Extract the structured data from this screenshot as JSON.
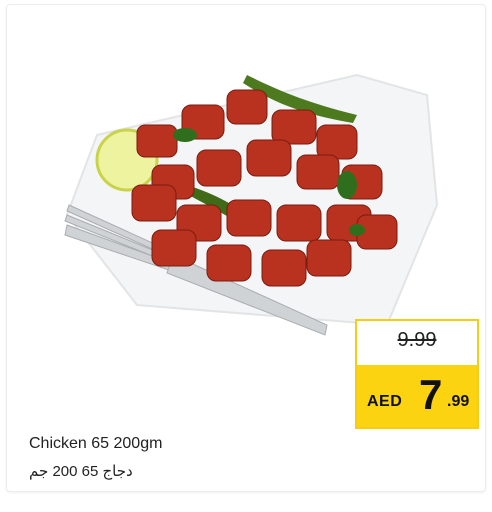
{
  "product": {
    "name_en": "Chicken 65 200gm",
    "name_ar": "دجاج 65  200 جم",
    "image": "chicken-65-plate-image"
  },
  "pricing": {
    "old_price": "9.99",
    "currency": "AED",
    "price_integer": "7",
    "price_decimal": ".99"
  },
  "colors": {
    "price_band": "#fbd311",
    "price_border": "#f7cd12",
    "text": "#222222"
  }
}
